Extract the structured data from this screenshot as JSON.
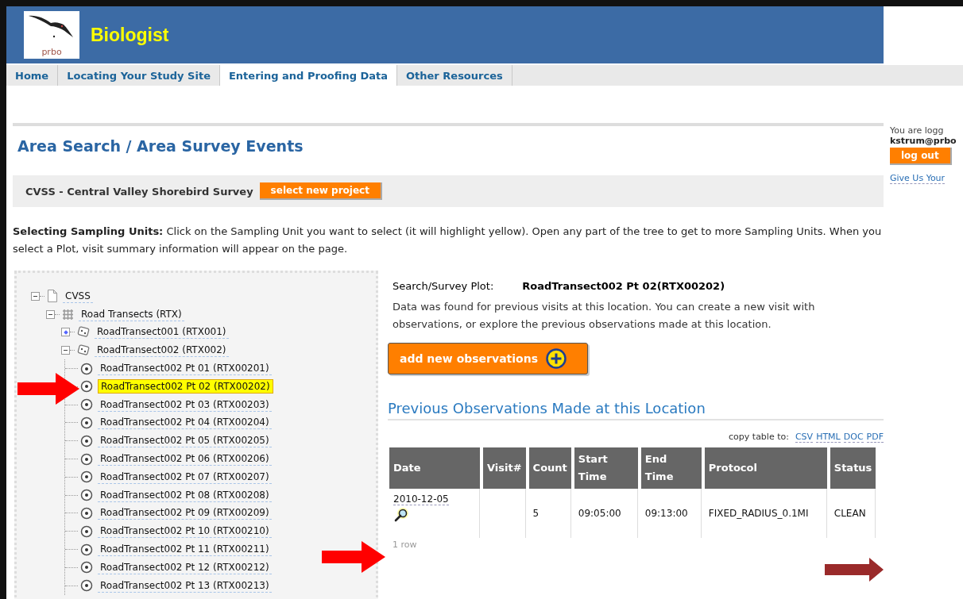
{
  "header": {
    "logo_text": "prbo",
    "title": "Biologist"
  },
  "tabs": [
    {
      "label": "Home",
      "selected": false
    },
    {
      "label": "Locating Your Study Site",
      "selected": false
    },
    {
      "label": "Entering and Proofing Data",
      "selected": true
    },
    {
      "label": "Other Resources",
      "selected": false
    }
  ],
  "page_title": "Area Search / Area Survey Events",
  "project": {
    "name": "CVSS - Central Valley Shorebird Survey",
    "button": "select new project"
  },
  "instructions": "**Selecting Sampling Units:** Click on the Sampling Unit you want to select (it will highlight yellow). Open any part of the tree to get to more Sampling Units. When you select a Plot, visit summary information will appear on the page.",
  "tree": [
    {
      "label": "CVSS",
      "kind": "document",
      "expanded": true,
      "children": [
        {
          "label": "Road Transects (RTX)",
          "kind": "grid",
          "expanded": true,
          "children": [
            {
              "label": "RoadTransect001 (RTX001)",
              "kind": "transect",
              "expanded": false
            },
            {
              "label": "RoadTransect002 (RTX002)",
              "kind": "transect",
              "expanded": true,
              "children": [
                {
                  "label": "RoadTransect002 Pt 01 (RTX00201)",
                  "kind": "point",
                  "selected": false
                },
                {
                  "label": "RoadTransect002 Pt 02 (RTX00202)",
                  "kind": "point",
                  "selected": true
                },
                {
                  "label": "RoadTransect002 Pt 03 (RTX00203)",
                  "kind": "point",
                  "selected": false
                },
                {
                  "label": "RoadTransect002 Pt 04 (RTX00204)",
                  "kind": "point",
                  "selected": false
                },
                {
                  "label": "RoadTransect002 Pt 05 (RTX00205)",
                  "kind": "point",
                  "selected": false
                },
                {
                  "label": "RoadTransect002 Pt 06 (RTX00206)",
                  "kind": "point",
                  "selected": false
                },
                {
                  "label": "RoadTransect002 Pt 07 (RTX00207)",
                  "kind": "point",
                  "selected": false
                },
                {
                  "label": "RoadTransect002 Pt 08 (RTX00208)",
                  "kind": "point",
                  "selected": false
                },
                {
                  "label": "RoadTransect002 Pt 09 (RTX00209)",
                  "kind": "point",
                  "selected": false
                },
                {
                  "label": "RoadTransect002 Pt 10 (RTX00210)",
                  "kind": "point",
                  "selected": false
                },
                {
                  "label": "RoadTransect002 Pt 11 (RTX00211)",
                  "kind": "point",
                  "selected": false
                },
                {
                  "label": "RoadTransect002 Pt 12 (RTX00212)",
                  "kind": "point",
                  "selected": false
                },
                {
                  "label": "RoadTransect002 Pt 13 (RTX00213)",
                  "kind": "point",
                  "selected": false
                }
              ]
            }
          ]
        }
      ]
    }
  ],
  "plot": {
    "label": "Search/Survey Plot:",
    "value": "RoadTransect002 Pt 02(RTX00202)",
    "message": "Data was found for previous visits at this location. You can create a new visit with observations, or explore the previous observations made at this location.",
    "add_button": "add new observations"
  },
  "observations": {
    "heading": "Previous Observations Made at this Location",
    "copy_label": "copy table to:",
    "formats": [
      "CSV",
      "HTML",
      "DOC",
      "PDF"
    ],
    "columns": [
      "Date",
      "Visit#",
      "Count",
      "Start Time",
      "End Time",
      "Protocol",
      "Status"
    ],
    "rows": [
      {
        "date": "2010-12-05",
        "count": "5",
        "start_time": "09:05:00",
        "end_time": "09:13:00",
        "protocol": "FIXED_RADIUS_0.1MI",
        "status": "CLEAN"
      }
    ],
    "row_count": "1 row"
  },
  "account": {
    "status": "You are logg",
    "user": "kstrum@prbo",
    "logout": "log out",
    "feedback": "Give Us Your"
  }
}
